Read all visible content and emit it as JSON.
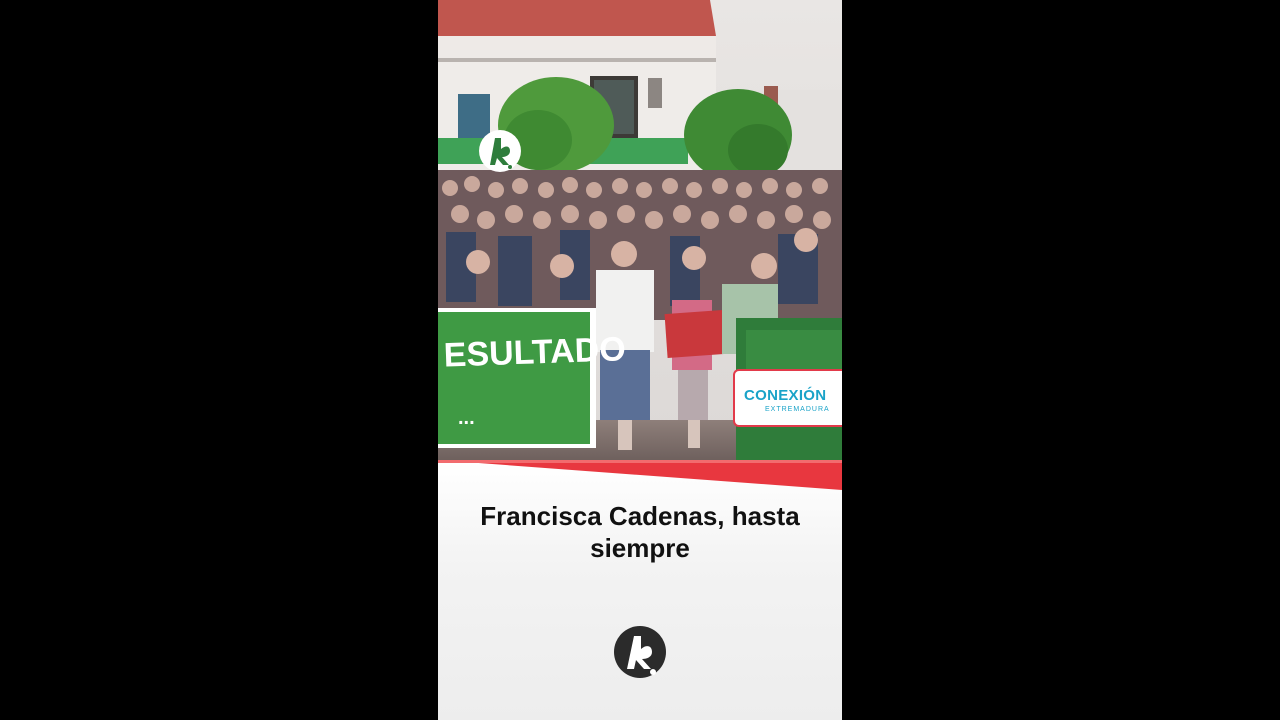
{
  "headline": "Francisca Cadenas, hasta siempre",
  "banner_text": "ESULTADO",
  "banner_dots": "...",
  "overlay_logo": {
    "brand": "CONEXIÓN",
    "subtitle": "EXTREMADURA"
  },
  "colors": {
    "background": "#000000",
    "accent_red": "#e8373f",
    "banner_green": "#3f9a44",
    "brand_blue": "#1aa3c8",
    "logo_dark": "#2b2b2b",
    "logo_green": "#2e7d3c"
  },
  "icons": {
    "channel_logo_top": "channel-logo-icon",
    "channel_logo_bottom": "channel-logo-icon"
  }
}
